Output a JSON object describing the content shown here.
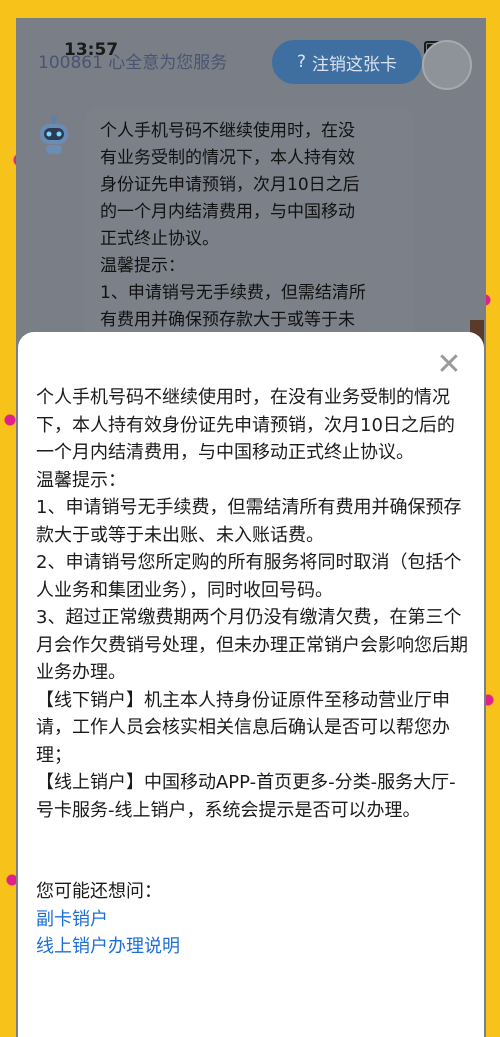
{
  "status": {
    "time": "13:57"
  },
  "chat": {
    "service_text": "100861 心全意为您服务",
    "cancel_button": "注销这张卡",
    "cancel_icon": "?",
    "bubble_lines": [
      "个人手机号码不继续使用时，在没",
      "有业务受制的情况下，本人持有效",
      "身份证先申请预销，次月10日之后",
      "的一个月内结清费用，与中国移动",
      "正式终止协议。",
      "温馨提示：",
      "1、申请销号无手续费，但需结清所",
      "有费用并确保预存款大于或等于未"
    ]
  },
  "modal": {
    "close_icon": "✕",
    "paragraphs": [
      "个人手机号码不继续使用时，在没有业务受制的情况下，本人持有效身份证先申请预销，次月10日之后的一个月内结清费用，与中国移动正式终止协议。",
      "温馨提示：",
      "1、申请销号无手续费，但需结清所有费用并确保预存款大于或等于未出账、未入账话费。",
      "2、申请销号您所定购的所有服务将同时取消（包括个人业务和集团业务），同时收回号码。",
      "3、超过正常缴费期两个月仍没有缴清欠费，在第三个月会作欠费销号处理，但未办理正常销户会影响您后期业务办理。",
      "【线下销户】机主本人持身份证原件至移动营业厅申请，工作人员会核实相关信息后确认是否可以帮您办理；",
      "【线上销户】中国移动APP-首页更多-分类-服务大厅-号卡服务-线上销户，系统会提示是否可以办理。"
    ],
    "suggest_title": "您可能还想问：",
    "suggest_links": [
      "副卡销户",
      "线上销户办理说明"
    ]
  },
  "colors": {
    "frame": "#f7c21a",
    "link": "#1d6fd8",
    "pill": "#3f6fa0"
  }
}
